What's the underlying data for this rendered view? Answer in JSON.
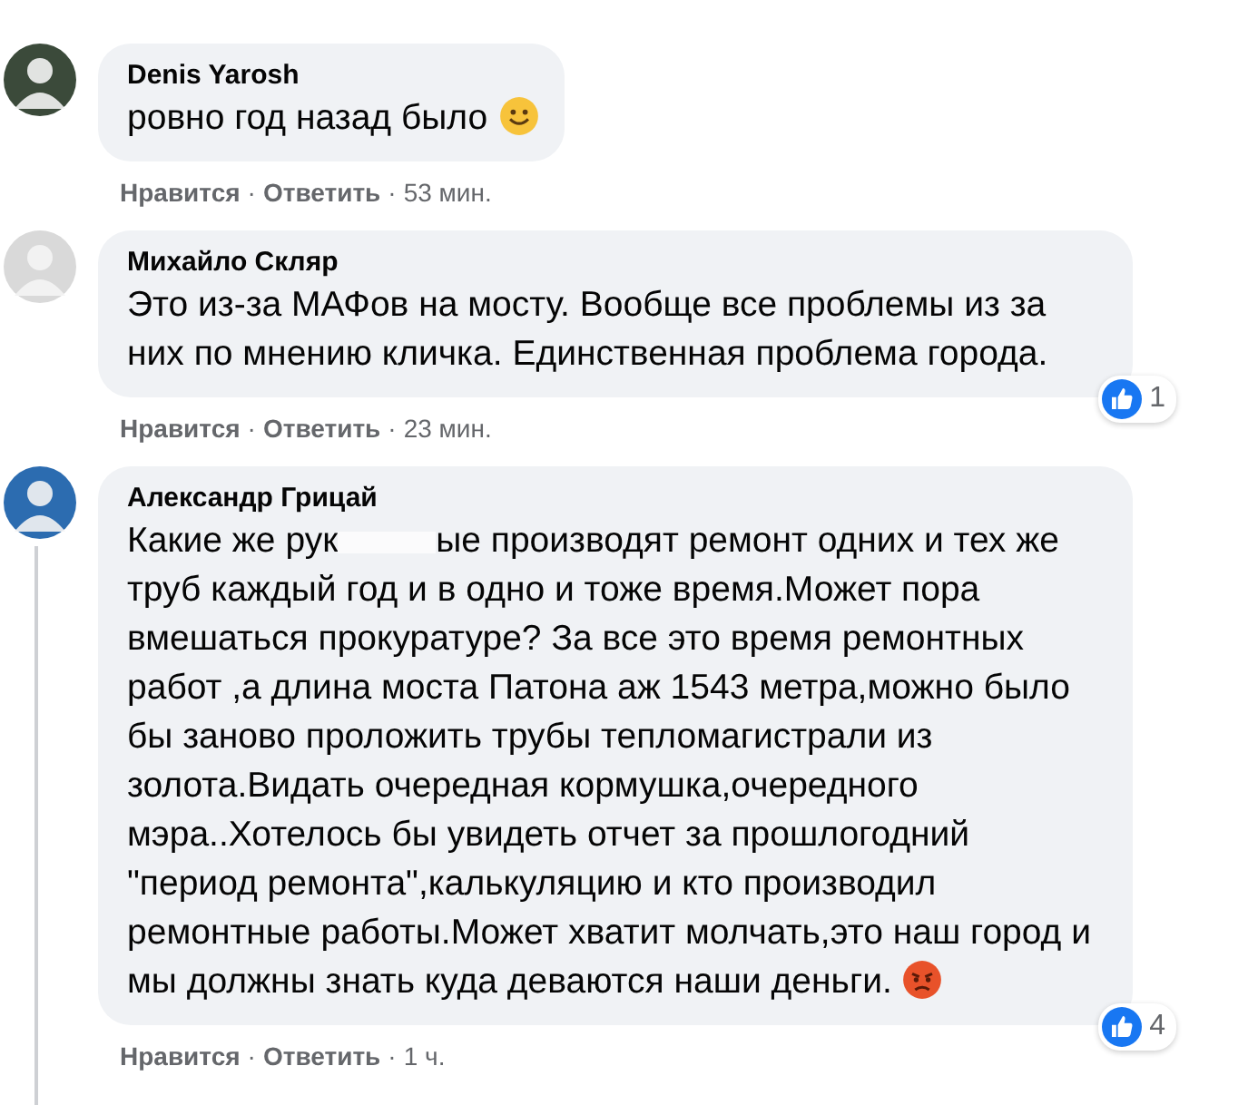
{
  "comments": [
    {
      "author": "Denis Yarosh",
      "text": "ровно год назад было",
      "emoji": {
        "kind": "smile"
      },
      "like": "Нравится",
      "separator": "·",
      "reply": "Ответить",
      "time": "53 мин.",
      "has_replies": false
    },
    {
      "author": "Михайло Скляр",
      "text": "Это из-за МАФов на мосту. Вообще все проблемы из за них по мнению кличка. Единственная проблема города.",
      "reactions": "1",
      "like": "Нравится",
      "separator": "·",
      "reply": "Ответить",
      "time": "23 мин.",
      "has_replies": false
    },
    {
      "author": "Александр Грицай",
      "text_start": "Какие же рук",
      "redacted": true,
      "text": "ые производят ремонт одних и тех же труб каждый год и в одно и тоже время.Может пора вмешаться прокуратуре? За все это время ремонтных работ ,а длина моста Патона аж 1543 метра,можно было бы заново проложить трубы тепломагистрали из золота.Видать очередная кормушка,очередного мэра..Хотелось бы увидеть отчет за прошлогодний \"период ремонта\",калькуляцию и кто производил ремонтные работы.Может хватит молчать,это наш город и мы должны знать куда деваются наши деньги.",
      "emoji": {
        "kind": "angry"
      },
      "reactions": "4",
      "like": "Нравится",
      "separator": "·",
      "reply": "Ответить",
      "time": "1 ч.",
      "has_replies": true
    }
  ]
}
